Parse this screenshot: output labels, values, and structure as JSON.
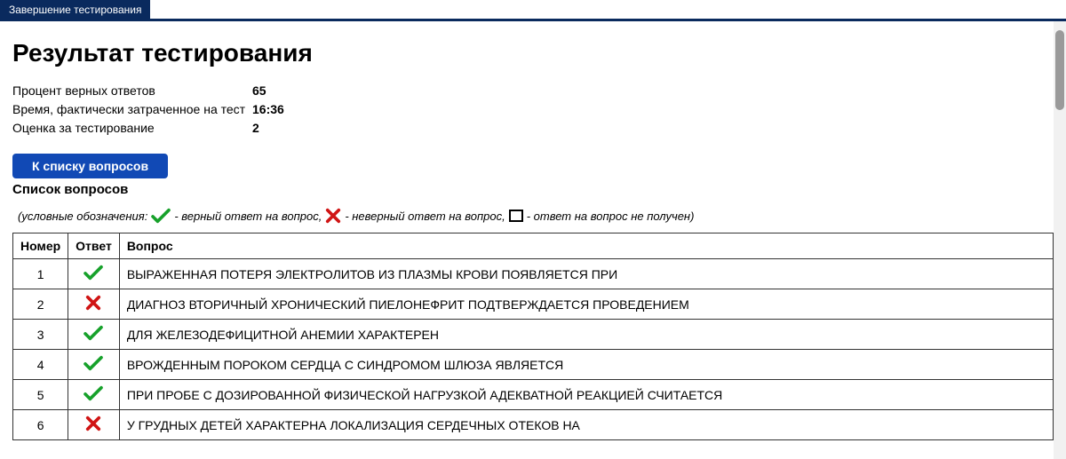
{
  "topbar": {
    "tab_label": "Завершение тестирования"
  },
  "page_title": "Результат тестирования",
  "stats": {
    "percent_label": "Процент верных ответов",
    "percent_value": "65",
    "time_label": "Время, фактически затраченное на тест",
    "time_value": "16:36",
    "grade_label": "Оценка за тестирование",
    "grade_value": "2"
  },
  "buttons": {
    "to_list_label": "К списку вопросов"
  },
  "list_title": "Список вопросов",
  "legend": {
    "prefix": "(условные обозначения:",
    "correct_text": " - верный ответ на вопрос,",
    "wrong_text": " - неверный ответ на вопрос,",
    "missing_text": " - ответ на вопрос не получен)"
  },
  "table": {
    "headers": {
      "num": "Номер",
      "answer": "Ответ",
      "question": "Вопрос"
    },
    "rows": [
      {
        "num": "1",
        "status": "correct",
        "question": "ВЫРАЖЕННАЯ ПОТЕРЯ ЭЛЕКТРОЛИТОВ ИЗ ПЛАЗМЫ КРОВИ ПОЯВЛЯЕТСЯ ПРИ"
      },
      {
        "num": "2",
        "status": "wrong",
        "question": "ДИАГНОЗ ВТОРИЧНЫЙ ХРОНИЧЕСКИЙ ПИЕЛОНЕФРИТ ПОДТВЕРЖДАЕТСЯ ПРОВЕДЕНИЕМ"
      },
      {
        "num": "3",
        "status": "correct",
        "question": "ДЛЯ ЖЕЛЕЗОДЕФИЦИТНОЙ АНЕМИИ ХАРАКТЕРЕН"
      },
      {
        "num": "4",
        "status": "correct",
        "question": "ВРОЖДЕННЫМ ПОРОКОМ СЕРДЦА С СИНДРОМОМ ШЛЮЗА ЯВЛЯЕТСЯ"
      },
      {
        "num": "5",
        "status": "correct",
        "question": "ПРИ ПРОБЕ С ДОЗИРОВАННОЙ ФИЗИЧЕСКОЙ НАГРУЗКОЙ АДЕКВАТНОЙ РЕАКЦИЕЙ СЧИТАЕТСЯ"
      },
      {
        "num": "6",
        "status": "wrong",
        "question": "У ГРУДНЫХ ДЕТЕЙ ХАРАКТЕРНА ЛОКАЛИЗАЦИЯ СЕРДЕЧНЫХ ОТЕКОВ НА"
      }
    ]
  }
}
